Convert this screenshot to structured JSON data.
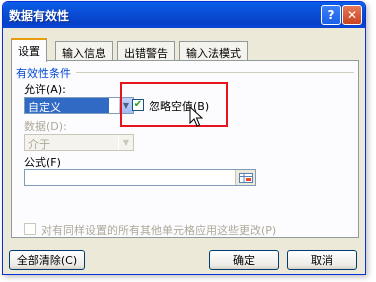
{
  "window": {
    "title": "数据有效性",
    "help_label": "?",
    "close_label": "✕"
  },
  "tabs": [
    {
      "label": "设置",
      "active": true
    },
    {
      "label": "输入信息",
      "active": false
    },
    {
      "label": "出错警告",
      "active": false
    },
    {
      "label": "输入法模式",
      "active": false
    }
  ],
  "validity": {
    "group_title": "有效性条件",
    "allow_label": "允许(A):",
    "allow_value": "自定义",
    "ignore_blank_label": "忽略空值(B)",
    "ignore_blank_checked": true,
    "data_label": "数据(D):",
    "data_value": "介于",
    "formula_label": "公式(F)",
    "formula_value": ""
  },
  "apply_all": {
    "label": "对有同样设置的所有其他单元格应用这些更改(P)",
    "checked": false
  },
  "buttons": {
    "clear_all": "全部清除(C)",
    "ok": "确定",
    "cancel": "取消"
  },
  "icons": {
    "dropdown": "chevron-down-icon",
    "range_ref": "range-select-icon",
    "cursor": "mouse-pointer-icon"
  },
  "colors": {
    "titlebar": "#0a4fd6",
    "selection": "#316ac5",
    "highlight_box": "#e8141b",
    "group_title": "#0046d5"
  }
}
